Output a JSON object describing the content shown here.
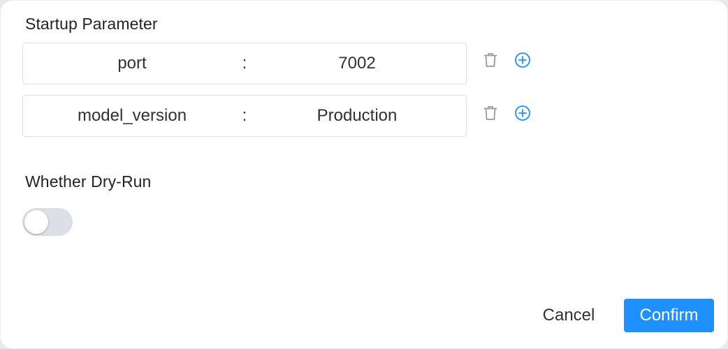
{
  "dialog": {
    "startup_label": "Startup Parameter",
    "params": [
      {
        "key": "port",
        "separator": ":",
        "value": "7002"
      },
      {
        "key": "model_version",
        "separator": ":",
        "value": "Production"
      }
    ],
    "dryrun_label": "Whether Dry-Run",
    "dryrun_enabled": false,
    "icons": {
      "delete": "trash-icon",
      "add": "plus-circle-icon"
    },
    "colors": {
      "accent": "#1e90ff",
      "icon_delete": "#9a9a9a",
      "toggle_off": "#dcdfe6"
    }
  },
  "footer": {
    "cancel_label": "Cancel",
    "confirm_label": "Confirm"
  }
}
